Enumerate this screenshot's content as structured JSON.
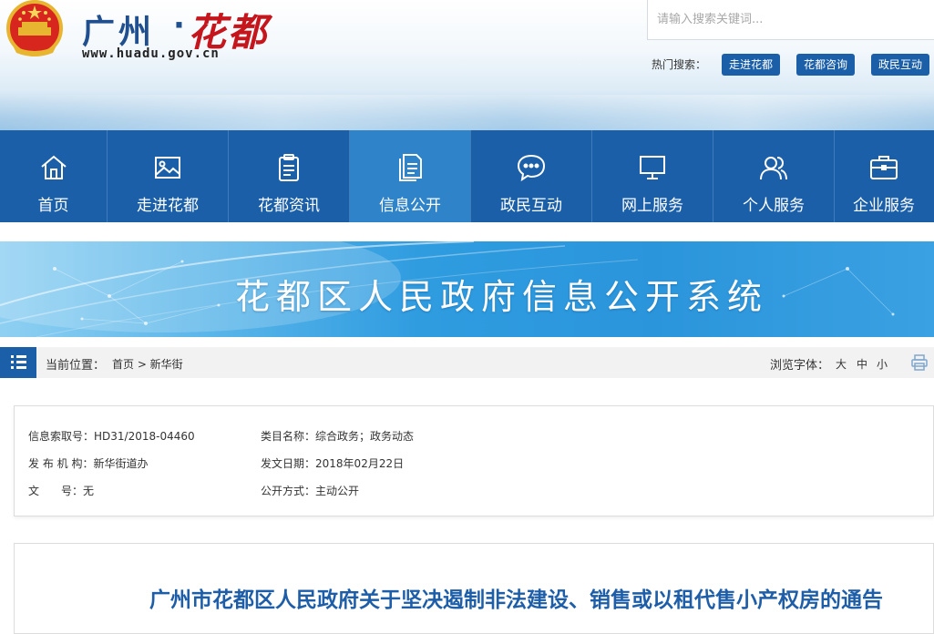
{
  "header": {
    "logo_city": "广州",
    "logo_dot": "·",
    "logo_brush": "花都",
    "logo_url": "www.huadu.gov.cn",
    "search_placeholder": "请输入搜索关键词...",
    "hot_label": "热门搜索：",
    "hot_tags": [
      "走进花都",
      "花都咨询",
      "政民互动"
    ]
  },
  "nav": {
    "items": [
      {
        "label": "首页",
        "icon": "home-icon"
      },
      {
        "label": "走进花都",
        "icon": "picture-icon"
      },
      {
        "label": "花都资讯",
        "icon": "clipboard-icon"
      },
      {
        "label": "信息公开",
        "icon": "document-icon"
      },
      {
        "label": "政民互动",
        "icon": "chat-icon"
      },
      {
        "label": "网上服务",
        "icon": "monitor-icon"
      },
      {
        "label": "个人服务",
        "icon": "users-icon"
      },
      {
        "label": "企业服务",
        "icon": "briefcase-icon"
      }
    ],
    "active_index": 3
  },
  "banner": {
    "title": "花都区人民政府信息公开系统"
  },
  "location": {
    "label": "当前位置：",
    "crumbs": "首页 > 新华街",
    "font_label": "浏览字体：",
    "font_options": [
      "大",
      "中",
      "小"
    ]
  },
  "info": {
    "index_no_label": "信息索取号：",
    "index_no_value": "HD31/2018-04460",
    "category_label": "类目名称：",
    "category_value": "综合政务；政务动态",
    "publisher_label": "发 布 机 构：",
    "publisher_value": "新华街道办",
    "date_label": "发文日期：",
    "date_value": "2018年02月22日",
    "doc_no_label": "文　　号：",
    "doc_no_value": "无",
    "open_mode_label": "公开方式：",
    "open_mode_value": "主动公开"
  },
  "article": {
    "title": "广州市花都区人民政府关于坚决遏制非法建设、销售或以租代售小产权房的通告"
  },
  "colors": {
    "nav_bg": "#1a5fa8",
    "nav_active": "#2f83c9",
    "title_blue": "#1e5ea8",
    "brush_red": "#c4161c"
  }
}
